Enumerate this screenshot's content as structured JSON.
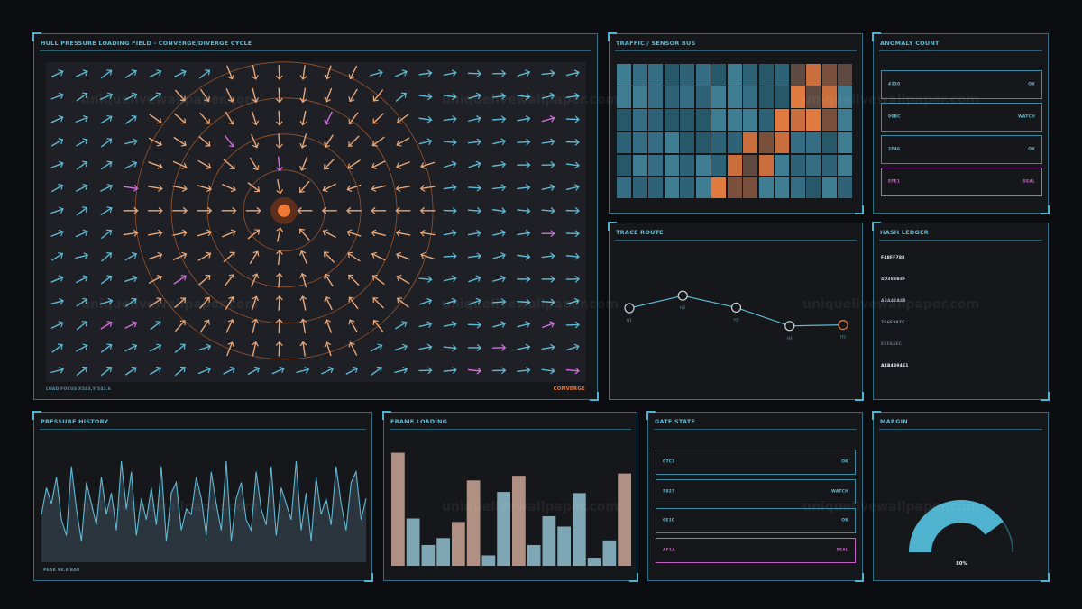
{
  "hull": {
    "title": "HULL PRESSURE LOADING FIELD - CONVERGE/DIVERGE CYCLE",
    "footer_left": "LOAD FOCUS  X543,Y 543.6",
    "footer_right": "CONVERGE",
    "mode": "converge",
    "focus_grid": {
      "col": 13,
      "row": 6
    },
    "colors": {
      "near": "#e8a87c",
      "far": "#5fb9d4",
      "anomaly": "#d36fe0",
      "focus": "#ee7a35"
    }
  },
  "traffic": {
    "title": "TRAFFIC / SENSOR BUS",
    "rows": 6,
    "cols": 15,
    "hot_cells": [
      [
        0,
        12
      ],
      [
        0,
        13
      ],
      [
        0,
        14
      ],
      [
        1,
        11
      ],
      [
        1,
        12
      ],
      [
        2,
        10
      ],
      [
        2,
        11
      ],
      [
        2,
        12
      ],
      [
        3,
        8
      ],
      [
        3,
        9
      ],
      [
        3,
        10
      ],
      [
        4,
        7
      ],
      [
        4,
        8
      ],
      [
        4,
        9
      ],
      [
        5,
        6
      ],
      [
        5,
        7
      ],
      [
        5,
        8
      ],
      [
        0,
        11
      ],
      [
        1,
        13
      ],
      [
        2,
        13
      ]
    ]
  },
  "anomaly": {
    "title": "ANOMALY COUNT",
    "rows": [
      {
        "key": "4330",
        "status": "OK"
      },
      {
        "key": "90BC",
        "status": "WATCH"
      },
      {
        "key": "2F46",
        "status": "OK"
      },
      {
        "key": "EFE1",
        "status": "SEAL"
      }
    ]
  },
  "trace": {
    "title": "TRACE ROUTE",
    "nodes": [
      {
        "label": "H1",
        "value": 0.35
      },
      {
        "label": "H2",
        "value": 0.58
      },
      {
        "label": "H3",
        "value": 0.36
      },
      {
        "label": "H4",
        "value": 0.02
      },
      {
        "label": "H5",
        "value": 0.04
      }
    ]
  },
  "hash": {
    "title": "HASH LEDGER",
    "entries": [
      "F48FF788",
      "4D383B4F",
      "A5A42A48",
      "7E6F987C",
      "E0FA4EC",
      "A4B4394E1"
    ]
  },
  "pressure": {
    "title": "PRESSURE HISTORY",
    "footer": "PEAK 98.8 BAR",
    "values": [
      0.45,
      0.7,
      0.55,
      0.8,
      0.4,
      0.25,
      0.9,
      0.5,
      0.2,
      0.75,
      0.55,
      0.35,
      0.8,
      0.45,
      0.65,
      0.3,
      0.95,
      0.5,
      0.85,
      0.25,
      0.6,
      0.4,
      0.7,
      0.35,
      0.9,
      0.2,
      0.65,
      0.75,
      0.3,
      0.5,
      0.45,
      0.8,
      0.6,
      0.25,
      0.85,
      0.55,
      0.3,
      0.95,
      0.2,
      0.6,
      0.75,
      0.4,
      0.3,
      0.85,
      0.5,
      0.35,
      0.9,
      0.25,
      0.7,
      0.55,
      0.4,
      0.95,
      0.3,
      0.65,
      0.2,
      0.8,
      0.45,
      0.6,
      0.35,
      0.9,
      0.55,
      0.3,
      0.75,
      0.85,
      0.4,
      0.6
    ]
  },
  "frame": {
    "title": "FRAME LOADING",
    "bars": [
      {
        "v": 0.98,
        "hot": true
      },
      {
        "v": 0.41,
        "hot": false
      },
      {
        "v": 0.18,
        "hot": false
      },
      {
        "v": 0.24,
        "hot": false
      },
      {
        "v": 0.38,
        "hot": true
      },
      {
        "v": 0.74,
        "hot": true
      },
      {
        "v": 0.09,
        "hot": false
      },
      {
        "v": 0.64,
        "hot": false
      },
      {
        "v": 0.78,
        "hot": true
      },
      {
        "v": 0.18,
        "hot": false
      },
      {
        "v": 0.43,
        "hot": false
      },
      {
        "v": 0.34,
        "hot": false
      },
      {
        "v": 0.63,
        "hot": false
      },
      {
        "v": 0.07,
        "hot": false
      },
      {
        "v": 0.22,
        "hot": false
      },
      {
        "v": 0.8,
        "hot": true
      }
    ]
  },
  "gate": {
    "title": "GATE STATE",
    "rows": [
      {
        "key": "07C3",
        "status": "OK"
      },
      {
        "key": "5927",
        "status": "WATCH"
      },
      {
        "key": "6E10",
        "status": "OK"
      },
      {
        "key": "AF1A",
        "status": "SEAL"
      }
    ]
  },
  "margin": {
    "title": "MARGIN",
    "percent": 80,
    "label": "80%"
  },
  "watermark": "uniquelivewallpaper.com"
}
